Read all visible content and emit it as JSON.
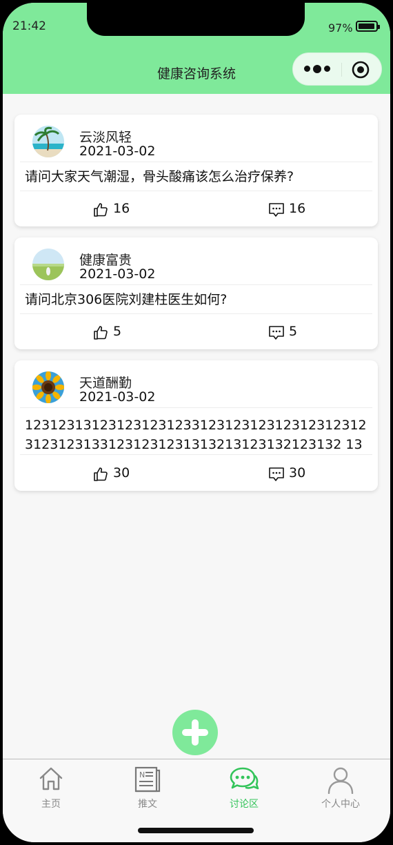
{
  "status": {
    "time": "21:42",
    "battery": "97%"
  },
  "header": {
    "title": "健康咨询系统"
  },
  "posts": [
    {
      "user": "云淡风轻",
      "date": "2021-03-02",
      "content": "请问大家天气潮湿，骨头酸痛该怎么治疗保养?",
      "likes": "16",
      "comments": "16"
    },
    {
      "user": "健康富贵",
      "date": "2021-03-02",
      "content": "请问北京306医院刘建柱医生如何?",
      "likes": "5",
      "comments": "5"
    },
    {
      "user": "天道酬勤",
      "date": "2021-03-02",
      "content": "1231231312312312312331231231231231231231231231231331231231231313213123132123132 13",
      "likes": "30",
      "comments": "30"
    }
  ],
  "tabs": [
    {
      "label": "主页",
      "icon": "home-icon"
    },
    {
      "label": "推文",
      "icon": "news-icon"
    },
    {
      "label": "讨论区",
      "icon": "chat-icon"
    },
    {
      "label": "个人中心",
      "icon": "person-icon"
    }
  ],
  "colors": {
    "accent": "#7fe99a",
    "active_tab": "#33c45a"
  }
}
